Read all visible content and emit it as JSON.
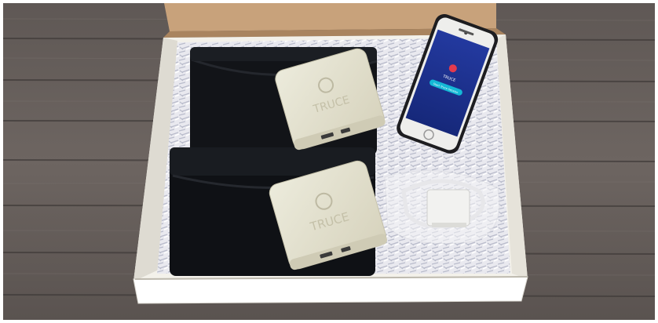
{
  "photo": {
    "subject": "product-box",
    "brand_text": "TRUCE",
    "phone_screen": {
      "brand_text": "TRUCE",
      "button_label": "Start Truce Session",
      "accent": "#14b8d6",
      "screen_color": "#1c2f8f"
    },
    "colors": {
      "wood": "#6c6460",
      "box_inside": "#f3f1ea",
      "box_flap": "#c8a27b",
      "pouch": "#101216",
      "device": "#e5e2cf"
    }
  }
}
